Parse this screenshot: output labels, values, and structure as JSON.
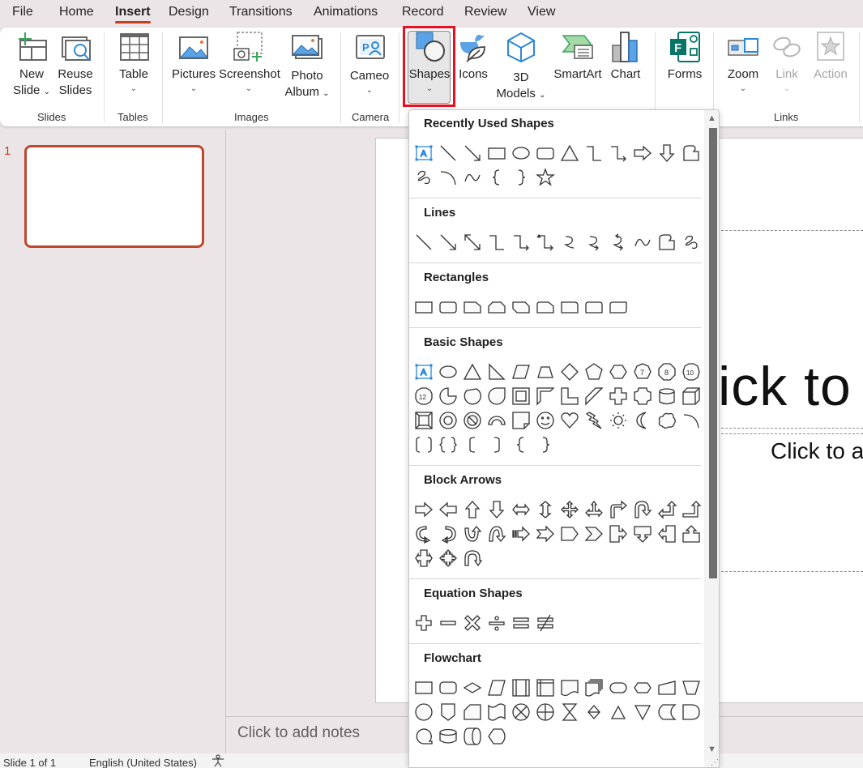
{
  "menu": {
    "tabs": [
      {
        "label": "File"
      },
      {
        "label": "Home"
      },
      {
        "label": "Insert",
        "active": true
      },
      {
        "label": "Design"
      },
      {
        "label": "Transitions"
      },
      {
        "label": "Animations"
      },
      {
        "label": "Record"
      },
      {
        "label": "Review"
      },
      {
        "label": "View"
      }
    ]
  },
  "ribbon": {
    "buttons": {
      "new_slide": {
        "line1": "New",
        "line2": "Slide"
      },
      "reuse_slides": {
        "line1": "Reuse",
        "line2": "Slides"
      },
      "table": {
        "label": "Table"
      },
      "pictures": {
        "label": "Pictures"
      },
      "screenshot": {
        "label": "Screenshot"
      },
      "photo_album": {
        "line1": "Photo",
        "line2": "Album"
      },
      "cameo": {
        "label": "Cameo"
      },
      "shapes": {
        "label": "Shapes"
      },
      "icons": {
        "label": "Icons"
      },
      "models3d": {
        "line1": "3D",
        "line2": "Models"
      },
      "smartart": {
        "label": "SmartArt"
      },
      "chart": {
        "label": "Chart"
      },
      "forms": {
        "label": "Forms"
      },
      "zoom": {
        "label": "Zoom"
      },
      "link": {
        "label": "Link"
      },
      "action": {
        "label": "Action"
      }
    },
    "groups": {
      "slides": "Slides",
      "tables": "Tables",
      "images": "Images",
      "camera": "Camera",
      "links": "Links"
    },
    "chevron": "⌄"
  },
  "slide_pane": {
    "slide_number": "1"
  },
  "slide": {
    "title_placeholder_visible": "lick to",
    "subtitle_placeholder_visible": "Click to a"
  },
  "notes": {
    "placeholder": "Click to add notes"
  },
  "status": {
    "slide_count": "Slide 1 of 1",
    "language": "English (United States)"
  },
  "shapes_gallery": {
    "sections": [
      {
        "title": "Recently Used Shapes",
        "rows": [
          [
            "text-box",
            "line",
            "line-arrow",
            "rectangle",
            "oval",
            "rounded-rectangle",
            "isosceles-triangle",
            "elbow-connector",
            "elbow-arrow-connector",
            "right-arrow",
            "down-arrow",
            "freeform-shape"
          ],
          [
            "scribble",
            "arc",
            "curve",
            "left-brace",
            "right-brace",
            "star-5-point"
          ]
        ]
      },
      {
        "title": "Lines",
        "rows": [
          [
            "line",
            "line-arrow",
            "line-double-arrow",
            "elbow-connector",
            "elbow-arrow-connector",
            "elbow-double-arrow-connector",
            "curved-connector",
            "curved-arrow-connector",
            "curved-double-arrow-connector",
            "curve",
            "freeform-shape",
            "scribble"
          ]
        ]
      },
      {
        "title": "Rectangles",
        "rows": [
          [
            "rectangle",
            "rounded-rectangle",
            "snip-single-corner",
            "snip-same-side",
            "snip-diagonal",
            "snip-round-single",
            "round-single-corner",
            "round-same-side",
            "round-diagonal"
          ]
        ]
      },
      {
        "title": "Basic Shapes",
        "rows": [
          [
            "text-box",
            "oval",
            "isosceles-triangle",
            "right-triangle",
            "parallelogram",
            "trapezoid",
            "diamond",
            "pentagon",
            "hexagon",
            "heptagon",
            "octagon",
            "decagon"
          ],
          [
            "dodecagon",
            "pie",
            "chord",
            "teardrop",
            "frame",
            "half-frame",
            "l-shape",
            "diagonal-stripe",
            "cross",
            "plaque",
            "can",
            "cube"
          ],
          [
            "bevel",
            "donut",
            "no-symbol",
            "block-arc",
            "folded-corner",
            "smiley-face",
            "heart",
            "lightning-bolt",
            "sun",
            "moon",
            "cloud",
            "arc"
          ],
          [
            "double-bracket",
            "double-brace",
            "left-bracket",
            "right-bracket",
            "left-brace",
            "right-brace"
          ]
        ]
      },
      {
        "title": "Block Arrows",
        "rows": [
          [
            "right-arrow",
            "left-arrow",
            "up-arrow",
            "down-arrow",
            "left-right-arrow",
            "up-down-arrow",
            "quad-arrow",
            "left-right-up-arrow",
            "bent-arrow",
            "u-turn-arrow",
            "left-up-arrow",
            "bent-up-arrow"
          ],
          [
            "curved-right-arrow",
            "curved-left-arrow",
            "curved-up-arrow",
            "curved-down-arrow",
            "striped-right-arrow",
            "notched-right-arrow",
            "pentagon-arrow",
            "chevron",
            "right-arrow-callout",
            "down-arrow-callout",
            "left-arrow-callout",
            "up-arrow-callout"
          ],
          [
            "left-right-arrow-callout",
            "quad-arrow-callout",
            "circular-arrow"
          ]
        ]
      },
      {
        "title": "Equation Shapes",
        "rows": [
          [
            "plus",
            "minus",
            "multiply",
            "division",
            "equal",
            "not-equal"
          ]
        ]
      },
      {
        "title": "Flowchart",
        "rows": [
          [
            "process",
            "alternate-process",
            "decision",
            "data",
            "predefined-process",
            "internal-storage",
            "document",
            "multidocument",
            "terminator",
            "preparation",
            "manual-input",
            "manual-operation"
          ],
          [
            "connector",
            "off-page-connector",
            "card",
            "punched-tape",
            "summing-junction",
            "or",
            "collate",
            "sort",
            "extract",
            "merge",
            "stored-data",
            "delay"
          ],
          [
            "sequential-access-storage",
            "magnetic-disk",
            "direct-access-storage",
            "display"
          ]
        ]
      }
    ]
  }
}
